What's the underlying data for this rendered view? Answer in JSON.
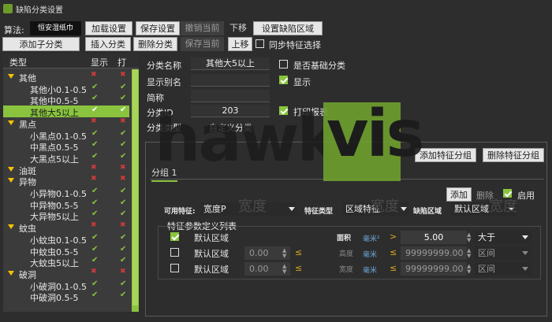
{
  "title": "缺陷分类设置",
  "toolbar": {
    "algo_label": "算法:",
    "algo_value": "恒安湿纸巾",
    "load": "加载设置",
    "save": "保存设置",
    "undo": "撤销当前",
    "move_down": "下移",
    "set_region": "设置缺陷区域",
    "add_sub": "添加子分类",
    "insert": "插入分类",
    "delete": "删除分类",
    "save_current": "保存当前",
    "move_up": "上移",
    "sync_label": "同步特征选择"
  },
  "tree": {
    "col_type": "类型",
    "col_show": "显示",
    "col_print": "打",
    "rows": [
      {
        "label": "其他",
        "level": 0
      },
      {
        "label": "其他小0.1-0.5",
        "level": 1
      },
      {
        "label": "其他中0.5-5",
        "level": 1
      },
      {
        "label": "其他大5以上",
        "level": 1,
        "selected": true
      },
      {
        "label": "黑点",
        "level": 0
      },
      {
        "label": "小黑点0.1-0.5",
        "level": 1
      },
      {
        "label": "中黑点0.5-5",
        "level": 1
      },
      {
        "label": "大黑点5以上",
        "level": 1
      },
      {
        "label": "油斑",
        "level": 0
      },
      {
        "label": "异物",
        "level": 0
      },
      {
        "label": "小异物0.1-0.5",
        "level": 1
      },
      {
        "label": "中异物0.5-5",
        "level": 1
      },
      {
        "label": "大异物5以上",
        "level": 1
      },
      {
        "label": "蚊虫",
        "level": 0
      },
      {
        "label": "小蚊虫0.1-0.5",
        "level": 1
      },
      {
        "label": "中蚊虫0.5-5",
        "level": 1
      },
      {
        "label": "大蚊虫5以上",
        "level": 1
      },
      {
        "label": "破洞",
        "level": 0
      },
      {
        "label": "小破洞0.1-0.5",
        "level": 1
      },
      {
        "label": "中破洞0.5-5",
        "level": 1
      }
    ]
  },
  "form": {
    "name_label": "分类名称",
    "name_value": "其他大5以上",
    "alias_label": "显示别名",
    "short_label": "简称",
    "id_label": "分类ID",
    "id_value": "203",
    "type_label": "分类类型",
    "type_value": "自定义分类",
    "is_base_label": "是否基础分类",
    "show_label": "显示",
    "print_label": "打印报表"
  },
  "group": {
    "add_feature_group": "添加特征分组",
    "delete_feature_group": "删除特征分组",
    "tab": "分组 1",
    "add": "添加",
    "delete": "删除",
    "enable": "启用",
    "available_label": "可用特征:",
    "available_value": "宽度P",
    "feature_type_label": "特征类型",
    "feature_type_value": "区域特征",
    "defect_region_label": "缺陷区域",
    "defect_region_value": "默认区域",
    "ghost_text": [
      "宽度",
      "宽度",
      "宽度"
    ],
    "params_title": "特征参数定义列表",
    "params": [
      {
        "checked": true,
        "region": "默认区域",
        "value": "",
        "sym": "",
        "feature": "面积",
        "unit": "毫米²",
        "op": ">",
        "num": "5.00",
        "cmp": "大于"
      },
      {
        "checked": false,
        "region": "默认区域",
        "value": "0.00",
        "sym": "≤",
        "feature": "高度",
        "unit": "毫米",
        "op": "≤",
        "num": "99999999.00",
        "cmp": "区间"
      },
      {
        "checked": false,
        "region": "默认区域",
        "value": "0.00",
        "sym": "≤",
        "feature": "宽度",
        "unit": "毫米",
        "op": "≤",
        "num": "99999999.00",
        "cmp": "区间"
      }
    ]
  },
  "watermark": {
    "left": "hawk",
    "right": "vis"
  },
  "colors": {
    "accent": "#8ac43f",
    "bg": "#2d2d2d",
    "warn": "#d9a520",
    "error": "#d23b3b"
  }
}
